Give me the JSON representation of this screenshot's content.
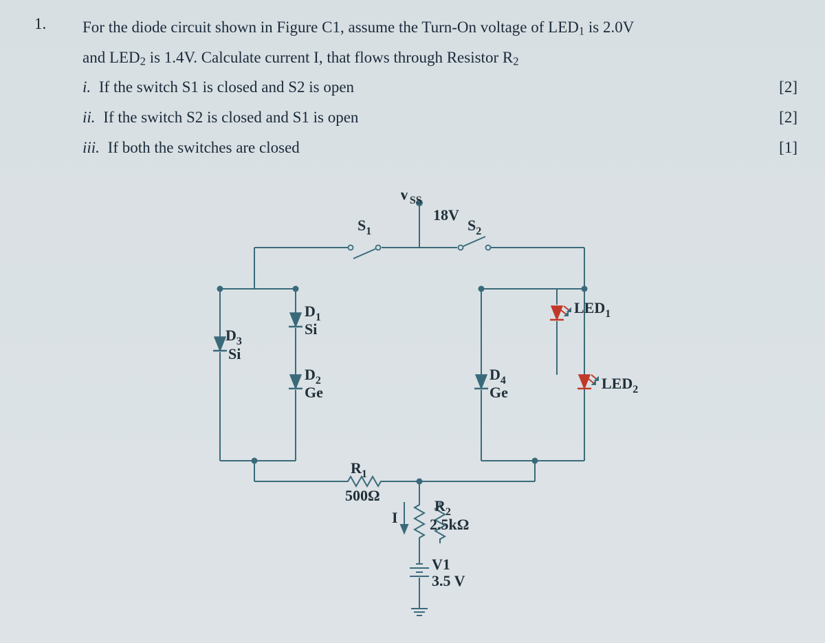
{
  "question": {
    "number": "1.",
    "line1_a": "For the diode circuit shown in Figure C1, assume the Turn-On voltage of LED",
    "line1_sub": "1",
    "line1_b": " is 2.0V",
    "line2_a": "and LED",
    "line2_sub": "2",
    "line2_b": " is 1.4V. Calculate current I, that flows through Resistor R",
    "line2_sub2": "2",
    "parts": [
      {
        "idx": "i.",
        "text": "If the switch S1 is closed and S2 is open",
        "marks": "[2]"
      },
      {
        "idx": "ii.",
        "text": "If the switch S2 is closed and S1 is open",
        "marks": "[2]"
      },
      {
        "idx": "iii.",
        "text": "If both the switches are closed",
        "marks": "[1]"
      }
    ]
  },
  "circuit": {
    "vss_label": "V",
    "vss_sub": "SS",
    "vss_value": "18V",
    "s1": "S",
    "s1_sub": "1",
    "s2": "S",
    "s2_sub": "2",
    "d1": "D",
    "d1_sub": "1",
    "d1_type": "Si",
    "d2": "D",
    "d2_sub": "2",
    "d2_type": "Ge",
    "d3": "D",
    "d3_sub": "3",
    "d3_type": "Si",
    "d4": "D",
    "d4_sub": "4",
    "d4_type": "Ge",
    "led1": "LED",
    "led1_sub": "1",
    "led2": "LED",
    "led2_sub": "2",
    "r1": "R",
    "r1_sub": "1",
    "r1_val": "500Ω",
    "r2": "R",
    "r2_sub": "2",
    "r2_val": "2.5kΩ",
    "i_label": "I",
    "v1": "V1",
    "v1_val": "3.5 V"
  },
  "colors": {
    "wire": "#3a6a7a",
    "text": "#20303a",
    "led": "#c03a2a"
  }
}
